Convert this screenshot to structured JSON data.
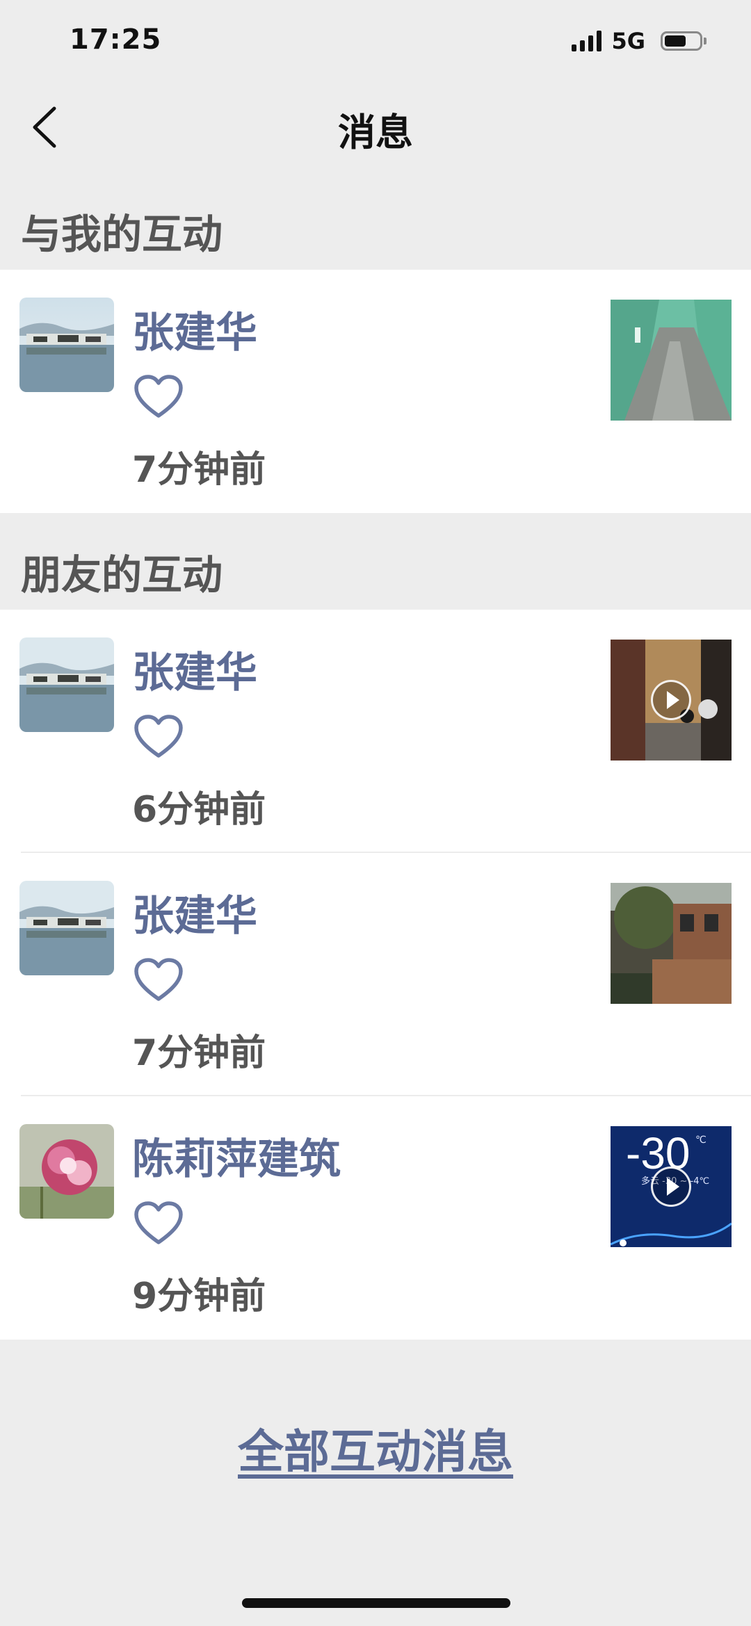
{
  "status_bar": {
    "time": "17:25",
    "network": "5G",
    "battery_level": 0.55,
    "icons": [
      "signal-bars-icon",
      "battery-icon"
    ]
  },
  "nav": {
    "title": "消息",
    "back_icon": "chevron-left-icon"
  },
  "sections": {
    "mine": {
      "title": "与我的互动",
      "items": [
        {
          "name": "张建华",
          "action_icon": "heart-outline-icon",
          "time": "7分钟前",
          "thumb": "corridor-photo",
          "is_video": false
        }
      ]
    },
    "friends": {
      "title": "朋友的互动",
      "items": [
        {
          "name": "张建华",
          "action_icon": "heart-outline-icon",
          "time": "6分钟前",
          "thumb": "restaurant-video",
          "is_video": true
        },
        {
          "name": "张建华",
          "action_icon": "heart-outline-icon",
          "time": "7分钟前",
          "thumb": "tree-building-photo",
          "is_video": false
        },
        {
          "name": "陈莉萍建筑",
          "action_icon": "heart-outline-icon",
          "time": "9分钟前",
          "thumb": "weather-video",
          "is_video": true,
          "thumb_text": {
            "temperature": "-30",
            "unit": "℃",
            "range": "多云 -30 ~ -4℃"
          }
        }
      ]
    }
  },
  "footer": {
    "all_link": "全部互动消息"
  },
  "colors": {
    "background": "#ededed",
    "name_text": "#5c6b95",
    "header_text": "#555555",
    "heart_stroke": "#6b7aa3"
  }
}
